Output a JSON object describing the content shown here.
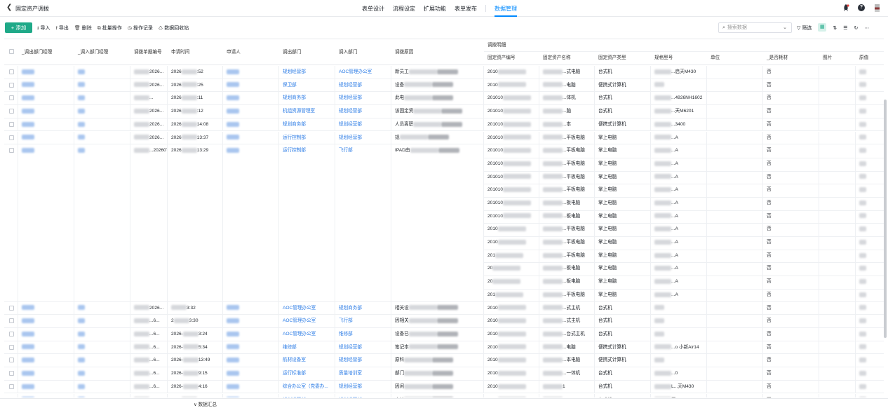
{
  "app": {
    "back_icon": "chevron-left-icon",
    "title": "固定资产调拨"
  },
  "nav": {
    "items": [
      "表单设计",
      "流程设定",
      "扩展功能",
      "表单发布"
    ],
    "active": "数据管理"
  },
  "toolbar": {
    "add_label": "+ 添加",
    "tools": [
      {
        "icon": "import-icon",
        "label": "导入"
      },
      {
        "icon": "export-icon",
        "label": "导出"
      },
      {
        "icon": "trash-icon",
        "label": "删除"
      },
      {
        "icon": "batch-icon",
        "label": "批量操作"
      },
      {
        "icon": "history-icon",
        "label": "操作记录"
      },
      {
        "icon": "recycle-icon",
        "label": "数据回收站"
      }
    ],
    "search_placeholder": "搜索数据",
    "filter_label": "筛选"
  },
  "table": {
    "group_header": "调拨明细",
    "headers": [
      "_调出部门经理",
      "_调入部门经理",
      "调拨单据编号",
      "申请时间",
      "申请人",
      "调出部门",
      "调入部门",
      "调拨原因",
      "固定资产编号",
      "固定资产名称",
      "固定资产类型",
      "规格型号",
      "单位",
      "_是否耗材",
      "图片",
      "原值"
    ],
    "rows": [
      {
        "num": "2026...",
        "time": "2026...:52",
        "out": "规划经营部",
        "in": "AOC管理办公室",
        "reason": "新员工",
        "code": "2010",
        "name": "...式电脑",
        "type": "台式机",
        "model": "...启天M430",
        "consumable": "否"
      },
      {
        "num": "2026...",
        "time": "2026...:25",
        "out": "保卫部",
        "in": "规划经营部",
        "reason": "设备",
        "code": "2010",
        "name": "...电脑",
        "type": "便携式计算机",
        "model": "",
        "consumable": "否"
      },
      {
        "num": "...",
        "time": "2026...:11",
        "out": "规划商务部",
        "in": "规划经营部",
        "reason": "此电",
        "code": "201010",
        "name": "...体机",
        "type": "台式机",
        "model": "...4926NH1602",
        "consumable": "否"
      },
      {
        "num": "2026...",
        "time": "2026...:12",
        "out": "机组资源管理室",
        "in": "规划经营部",
        "reason": "该固定资",
        "code": "201010",
        "name": "...脑",
        "type": "台式机",
        "model": "...天M6201",
        "consumable": "否"
      },
      {
        "num": "2026...",
        "time": "2026...14:08",
        "out": "规划商务部",
        "in": "规划经营部",
        "reason": "人员离职",
        "code": "201010",
        "name": "...本",
        "type": "便携式计算机",
        "model": "...3400",
        "consumable": "否"
      },
      {
        "num": "2026...",
        "time": "2026...13:37",
        "out": "运行控制部",
        "in": "规划经营部",
        "reason": "规",
        "code": "201010",
        "name": "...平板电脑",
        "type": "掌上电脑",
        "model": "...A",
        "consumable": "否"
      },
      {
        "num": "...202607",
        "time": "2026...13:29",
        "out": "运行控制部",
        "in": "飞行部",
        "reason": "IPAD由",
        "code": "201010",
        "name": "...平板电脑",
        "type": "掌上电脑",
        "model": "...A",
        "consumable": "否",
        "span": 12
      },
      {
        "num": "2026...",
        "time": "...3:32",
        "out": "AOC管理办公室",
        "in": "规划商务部",
        "reason": "相关设",
        "code": "2010",
        "name": "...式主机",
        "type": "台式机",
        "model": "",
        "consumable": "否"
      },
      {
        "num": "...6...",
        "time": "2...3:30",
        "out": "AOC管理办公室",
        "in": "飞行部",
        "reason": "因相关",
        "code": "2010",
        "name": "...式主机",
        "type": "台式机",
        "model": "",
        "consumable": "否"
      },
      {
        "num": "...6...",
        "time": "2026-...3:24",
        "out": "AOC管理办公室",
        "in": "维修部",
        "reason": "设备已",
        "code": "2010",
        "name": "...台式主机",
        "type": "台式机",
        "model": "",
        "consumable": "否"
      },
      {
        "num": "...6...",
        "time": "2026-...5:34",
        "out": "维修部",
        "in": "规划经营部",
        "reason": "笔记本",
        "code": "2010",
        "name": "...电脑",
        "type": "便携式计算机",
        "model": "...o 小新Air14",
        "consumable": "否"
      },
      {
        "num": "...6...",
        "time": "2026-...13:49",
        "out": "航材设备室",
        "in": "规划经营部",
        "reason": "原科",
        "code": "2010",
        "name": "...本电脑",
        "type": "便携式计算机",
        "model": "",
        "consumable": "否"
      },
      {
        "num": "...6...",
        "time": "2026-...9:15",
        "out": "运行标准部",
        "in": "质量培训室",
        "reason": "部门",
        "code": "2010",
        "name": "...一体机",
        "type": "台式机",
        "model": "...0",
        "consumable": "否"
      },
      {
        "num": "...6...",
        "time": "2026-...4:16",
        "out": "综合办公室（党委办...",
        "in": "规划经营部",
        "reason": "因闲",
        "code": "2010",
        "name": "1",
        "type": "台式机",
        "model": "L...天M430",
        "consumable": "否"
      },
      {
        "num": "...6...",
        "time": "2026...4:11",
        "out": "规划经营部",
        "in": "规划经营部",
        "reason": "由於",
        "code": "2010",
        "name": "1",
        "type": "台式机",
        "model": "天...O",
        "consumable": "否"
      }
    ],
    "sub_rows": [
      {
        "code": "201010",
        "name": "...平板电脑",
        "type": "掌上电脑",
        "model": "...A",
        "consumable": "否"
      },
      {
        "code": "201010",
        "name": "...平板电脑",
        "type": "掌上电脑",
        "model": "...A",
        "consumable": "否"
      },
      {
        "code": "201010",
        "name": "...平板电脑",
        "type": "掌上电脑",
        "model": "...A",
        "consumable": "否"
      },
      {
        "code": "201010",
        "name": "...板电脑",
        "type": "掌上电脑",
        "model": "...A",
        "consumable": "否"
      },
      {
        "code": "201010",
        "name": "...板电脑",
        "type": "掌上电脑",
        "model": "...A",
        "consumable": "否"
      },
      {
        "code": "2010",
        "name": "...平板电脑",
        "type": "掌上电脑",
        "model": "...A",
        "consumable": "否"
      },
      {
        "code": "2010",
        "name": "...平板电脑",
        "type": "掌上电脑",
        "model": "...A",
        "consumable": "否"
      },
      {
        "code": "201",
        "name": "...平板电脑",
        "type": "掌上电脑",
        "model": "...A",
        "consumable": "否"
      },
      {
        "code": "20",
        "name": "...板电脑",
        "type": "掌上电脑",
        "model": "...A",
        "consumable": "否"
      },
      {
        "code": "20",
        "name": "...板电脑",
        "type": "掌上电脑",
        "model": "...A",
        "consumable": "否"
      },
      {
        "code": "201",
        "name": "...平板电脑",
        "type": "掌上电脑",
        "model": "...A",
        "consumable": "否"
      },
      {
        "code": "20",
        "name": "...平板电脑",
        "type": "掌上电脑",
        "model": "...A",
        "consumable": "否"
      }
    ]
  },
  "footer": {
    "summary_label": "∨ 数据汇总"
  }
}
